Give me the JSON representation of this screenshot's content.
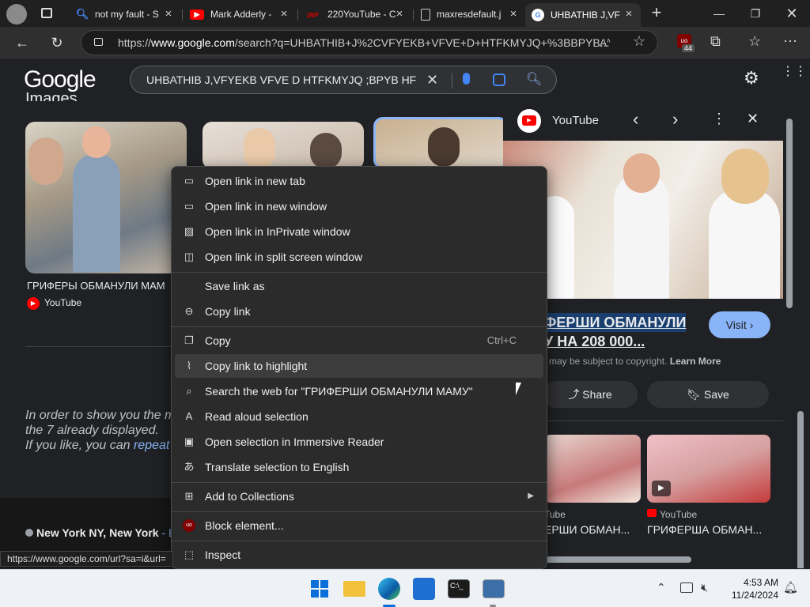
{
  "tabs": [
    {
      "label": "not my fault - S",
      "favicon": "search-favicon",
      "color": "#4285f4"
    },
    {
      "label": "Mark Adderly -",
      "favicon": "youtube-favicon",
      "color": "#ff0000"
    },
    {
      "label": "220YouTube - C",
      "favicon": "ppr-favicon",
      "color": "#e00000"
    },
    {
      "label": "maxresdefault.j",
      "favicon": "document-favicon",
      "color": "#cccccc"
    },
    {
      "label": "UHBATHIB J,VF",
      "favicon": "google-favicon",
      "color": "#4285f4"
    }
  ],
  "address": {
    "prefix": "https://",
    "domain": "www.google.com",
    "rest": "/search?q=UHBATHIB+J%2CVFYEKB+VFVE+D+HTFKMYJQ+%3BBPYB...",
    "extension_badge": "44"
  },
  "google": {
    "logo": "Google",
    "query": "UHBATHIB J,VFYEKB VFVE D HTFKMYJQ ;BPYB HF",
    "images_heading": "Images",
    "result1_title": "ГРИФЕРЫ ОБМАНУЛИ МАМ",
    "result1_source": "YouTube",
    "notice_line1": "In order to show you the m",
    "notice_line2": "the 7 already displayed.",
    "notice_line3a": "If you like, you can ",
    "notice_line3_link": "repeat",
    "location": "New York NY, New York",
    "location_suffix": " - Ba"
  },
  "panel": {
    "source": "YouTube",
    "title_line1": "ФЕРШИ ОБМАНУЛИ",
    "title_line2": "У НА 208 000...",
    "visit_label": "Visit",
    "copyright": "may be subject to copyright.",
    "learn_more": "Learn More",
    "share_label": "Share",
    "save_label": "Save",
    "related": [
      {
        "source": "Tube",
        "title": "ЕРШИ ОБМАН..."
      },
      {
        "source": "YouTube",
        "title": "ГРИФЕРША ОБМАН..."
      }
    ]
  },
  "context_menu": {
    "items": [
      {
        "label": "Open link in new tab",
        "icon": "new-tab-icon"
      },
      {
        "label": "Open link in new window",
        "icon": "new-window-icon"
      },
      {
        "label": "Open link in InPrivate window",
        "icon": "inprivate-icon"
      },
      {
        "label": "Open link in split screen window",
        "icon": "split-screen-icon"
      },
      {
        "label": "Save link as",
        "icon": ""
      },
      {
        "label": "Copy link",
        "icon": "link-icon"
      },
      {
        "label": "Copy",
        "icon": "copy-icon",
        "shortcut": "Ctrl+C"
      },
      {
        "label": "Copy link to highlight",
        "icon": "highlight-link-icon"
      },
      {
        "label": "Search the web for \"ГРИФЕРШИ ОБМАНУЛИ МАМУ\"",
        "icon": "search-icon"
      },
      {
        "label": "Read aloud selection",
        "icon": "read-aloud-icon"
      },
      {
        "label": "Open selection in Immersive Reader",
        "icon": "immersive-reader-icon"
      },
      {
        "label": "Translate selection to English",
        "icon": "translate-icon"
      },
      {
        "label": "Add to Collections",
        "icon": "collections-icon"
      },
      {
        "label": "Block element...",
        "icon": "ublock-icon"
      },
      {
        "label": "Inspect",
        "icon": "inspect-icon"
      }
    ]
  },
  "status_url": "https://www.google.com/url?sa=i&url=",
  "taskbar": {
    "time": "4:53 AM",
    "date": "11/24/2024"
  }
}
